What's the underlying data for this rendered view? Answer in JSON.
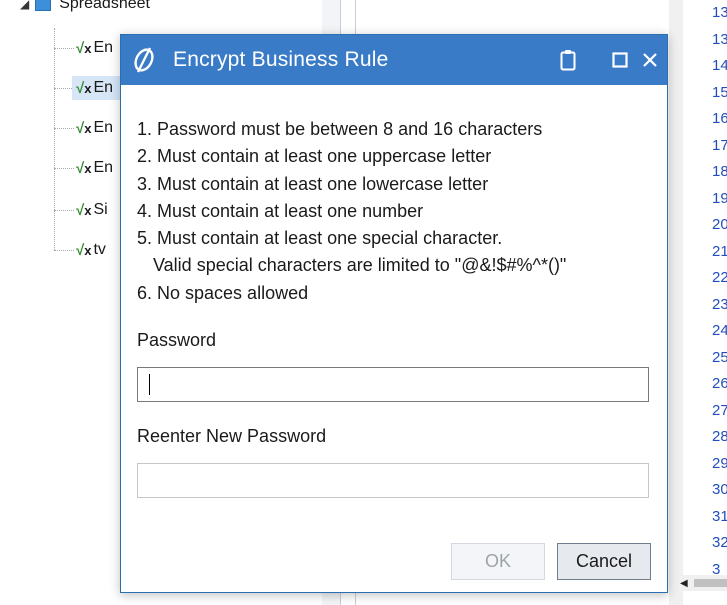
{
  "tree": {
    "root_label": "Spreadsheet",
    "children": [
      "En",
      "En",
      "En",
      "En",
      "Si",
      "tv"
    ]
  },
  "line_numbers": [
    "13",
    "13",
    "14",
    "15",
    "16",
    "17",
    "18",
    "19",
    "20",
    "21",
    "22",
    "23",
    "24",
    "25",
    "26",
    "27",
    "28",
    "29",
    "30",
    "31",
    "32",
    "3"
  ],
  "dialog": {
    "title": "Encrypt Business Rule",
    "rules": [
      "1. Password must be between 8 and 16 characters",
      "2. Must contain at least one uppercase letter",
      "3. Must contain at least one lowercase letter",
      "4. Must contain at least one number",
      "5. Must contain at least one special character.",
      "Valid special characters are limited to \"@&!$#%^*()\"",
      "6. No spaces allowed"
    ],
    "password_label": "Password",
    "password_value": "",
    "reenter_label": "Reenter New Password",
    "reenter_value": "",
    "ok_label": "OK",
    "ok_enabled": false,
    "cancel_label": "Cancel"
  },
  "icons": {
    "logo": "app-logo-icon",
    "clipboard": "clipboard-icon",
    "maximize": "maximize-icon",
    "close": "close-icon"
  },
  "colors": {
    "titlebar": "#3a7bc8",
    "accent": "#2a6fb0",
    "line_numbers": "#1f4fbf",
    "formula_icon": "#2e8b2e"
  }
}
